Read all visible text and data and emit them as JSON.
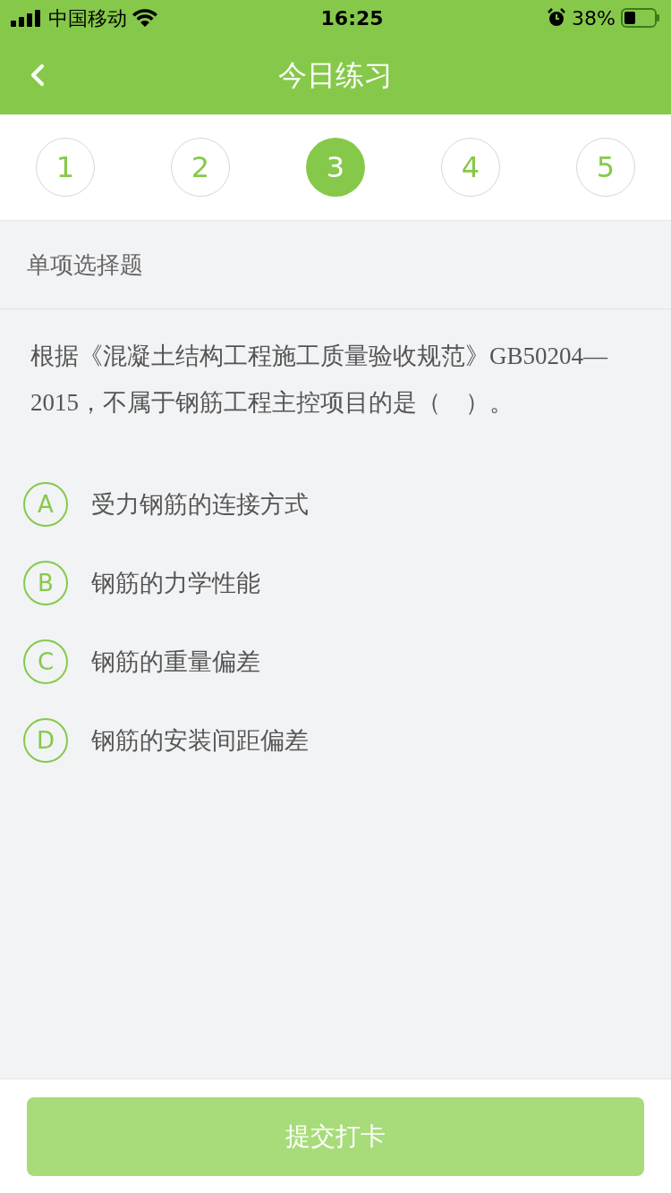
{
  "status_bar": {
    "carrier": "中国移动",
    "time": "16:25",
    "battery": "38%"
  },
  "header": {
    "title": "今日练习"
  },
  "steps": [
    {
      "label": "1",
      "selected": false
    },
    {
      "label": "2",
      "selected": false
    },
    {
      "label": "3",
      "selected": true
    },
    {
      "label": "4",
      "selected": false
    },
    {
      "label": "5",
      "selected": false
    }
  ],
  "section": "单项选择题",
  "question": "根据《混凝土结构工程施工质量验收规范》GB50204—2015，不属于钢筋工程主控项目的是（　）。",
  "options": [
    {
      "letter": "A",
      "text": "受力钢筋的连接方式",
      "selected": false
    },
    {
      "letter": "B",
      "text": "钢筋的力学性能",
      "selected": false
    },
    {
      "letter": "C",
      "text": "钢筋的重量偏差",
      "selected": false
    },
    {
      "letter": "D",
      "text": "钢筋的安装间距偏差",
      "selected": false
    }
  ],
  "submit": {
    "label": "提交打卡",
    "disabled": true
  }
}
